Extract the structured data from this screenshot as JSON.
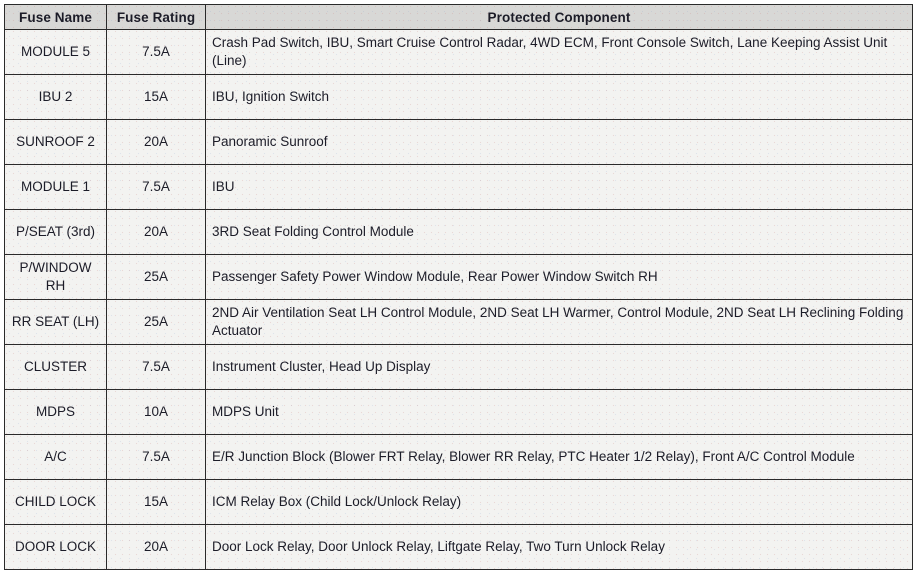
{
  "table": {
    "name": "fuse-information-table",
    "columns": [
      {
        "key": "fuse_name",
        "label": "Fuse Name",
        "align": "center"
      },
      {
        "key": "fuse_rating",
        "label": "Fuse Rating",
        "align": "center"
      },
      {
        "key": "protected_component",
        "label": "Protected Component",
        "align": "left"
      }
    ],
    "colors": {
      "header_background": "#d8d8d6",
      "cell_background": "#f3f3f1",
      "border": "#2a2a2a",
      "text": "#1c1c28",
      "page_background": "#ffffff"
    },
    "rows": [
      {
        "fuse_name": "MODULE 5",
        "fuse_rating": "7.5A",
        "protected_component": "Crash Pad Switch, IBU, Smart Cruise Control Radar, 4WD ECM, Front Console Switch, Lane Keeping Assist Unit (Line)"
      },
      {
        "fuse_name": "IBU 2",
        "fuse_rating": "15A",
        "protected_component": "IBU, Ignition Switch"
      },
      {
        "fuse_name": "SUNROOF 2",
        "fuse_rating": "20A",
        "protected_component": "Panoramic Sunroof"
      },
      {
        "fuse_name": "MODULE 1",
        "fuse_rating": "7.5A",
        "protected_component": "IBU"
      },
      {
        "fuse_name": "P/SEAT (3rd)",
        "fuse_rating": "20A",
        "protected_component": "3RD Seat Folding Control Module"
      },
      {
        "fuse_name": "P/WINDOW\nRH",
        "fuse_rating": "25A",
        "protected_component": "Passenger Safety Power Window Module, Rear Power Window Switch RH"
      },
      {
        "fuse_name": "RR SEAT (LH)",
        "fuse_rating": "25A",
        "protected_component": "2ND Air Ventilation Seat LH Control Module, 2ND Seat LH Warmer, Control Module, 2ND Seat LH Reclining Folding Actuator"
      },
      {
        "fuse_name": "CLUSTER",
        "fuse_rating": "7.5A",
        "protected_component": "Instrument Cluster, Head Up Display"
      },
      {
        "fuse_name": "MDPS",
        "fuse_rating": "10A",
        "protected_component": "MDPS Unit"
      },
      {
        "fuse_name": "A/C",
        "fuse_rating": "7.5A",
        "protected_component": "E/R Junction Block (Blower FRT Relay, Blower RR Relay, PTC Heater 1/2 Relay), Front A/C Control Module"
      },
      {
        "fuse_name": "CHILD LOCK",
        "fuse_rating": "15A",
        "protected_component": "ICM Relay Box (Child Lock/Unlock Relay)"
      },
      {
        "fuse_name": "DOOR LOCK",
        "fuse_rating": "20A",
        "protected_component": "Door Lock Relay, Door Unlock Relay, Liftgate Relay, Two Turn Unlock Relay"
      }
    ]
  }
}
